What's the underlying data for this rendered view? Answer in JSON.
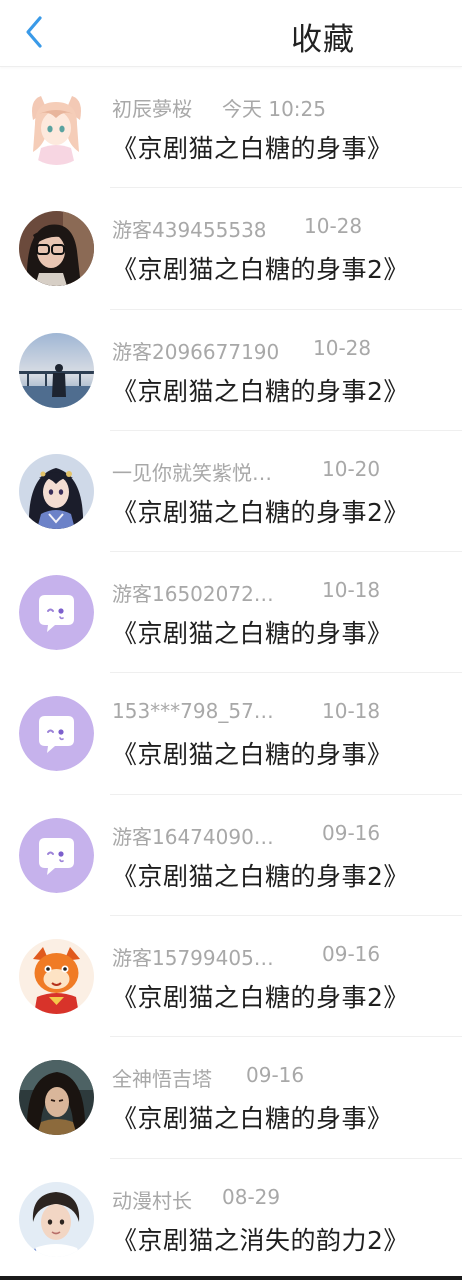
{
  "header": {
    "title": "收藏",
    "back_icon": "chevron-left-icon",
    "accent_color": "#3a9ae8"
  },
  "items": [
    {
      "user": "初辰夢桜",
      "time": "今天 10:25",
      "title": "《京剧猫之白糖的身事》",
      "avatar": "anime-fox-girl-avatar"
    },
    {
      "user": "游客439455538",
      "time": "10-28",
      "title": "《京剧猫之白糖的身事2》",
      "avatar": "girl-glasses-photo-avatar"
    },
    {
      "user": "游客2096677190",
      "time": "10-28",
      "title": "《京剧猫之白糖的身事2》",
      "avatar": "seaside-silhouette-avatar"
    },
    {
      "user": "一见你就笑紫悦…",
      "time": "10-20",
      "title": "《京剧猫之白糖的身事2》",
      "avatar": "fantasy-lady-avatar"
    },
    {
      "user": "游客16502072…",
      "time": "10-18",
      "title": "《京剧猫之白糖的身事》",
      "avatar": "default-chat-bubble-avatar"
    },
    {
      "user": "153***798_57…",
      "time": "10-18",
      "title": "《京剧猫之白糖的身事》",
      "avatar": "default-chat-bubble-avatar"
    },
    {
      "user": "游客16474090…",
      "time": "09-16",
      "title": "《京剧猫之白糖的身事2》",
      "avatar": "default-chat-bubble-avatar"
    },
    {
      "user": "游客15799405…",
      "time": "09-16",
      "title": "《京剧猫之白糖的身事2》",
      "avatar": "cartoon-cat-avatar"
    },
    {
      "user": "全神悟吉塔",
      "time": "09-16",
      "title": "《京剧猫之白糖的身事》",
      "avatar": "anime-warrior-avatar"
    },
    {
      "user": "动漫村长",
      "time": "08-29",
      "title": "《京剧猫之消失的韵力2》",
      "avatar": "young-man-photo-avatar"
    }
  ]
}
